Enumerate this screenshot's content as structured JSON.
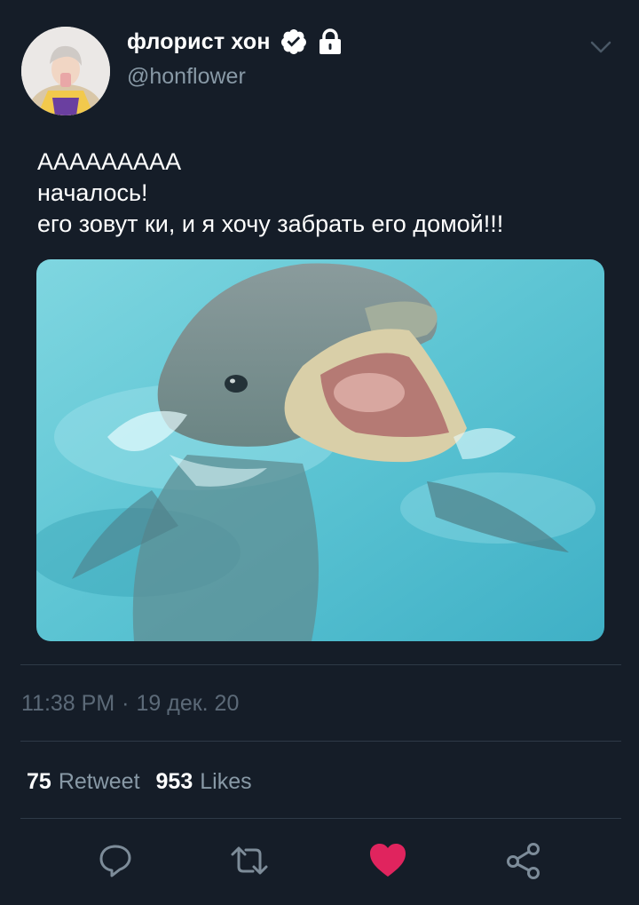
{
  "user": {
    "display_name": "флорист хон",
    "handle": "@honflower",
    "verified": true,
    "protected": true
  },
  "tweet": {
    "lines": [
      "ААААААААА",
      "началось!",
      "его зовут ки, и я хочу забрать его домой!!!"
    ],
    "time": "11:38 PM",
    "separator": "·",
    "date": "19 дек. 20"
  },
  "stats": {
    "retweets_count": "75",
    "retweets_label": "Retweet",
    "likes_count": "953",
    "likes_label": "Likes"
  },
  "actions": {
    "reply_icon": "reply-icon",
    "retweet_icon": "retweet-icon",
    "like_icon": "heart-icon",
    "share_icon": "share-icon",
    "liked": true
  },
  "colors": {
    "background": "#151d28",
    "text": "#ffffff",
    "secondary": "#8899a6",
    "like": "#e0245e"
  }
}
